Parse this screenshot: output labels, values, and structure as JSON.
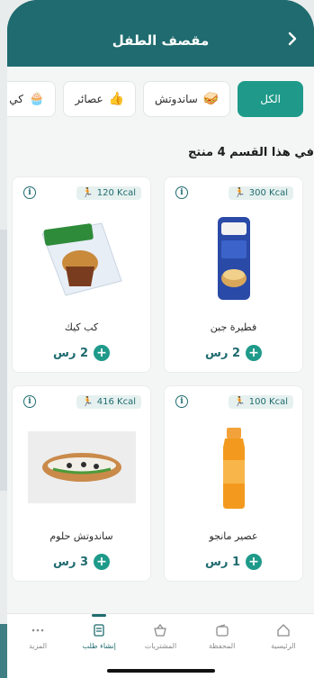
{
  "header": {
    "title": "مقصف الطفل"
  },
  "categories": [
    {
      "label": "الكل",
      "icon": "",
      "active": true
    },
    {
      "label": "ساندوتش",
      "icon": "🥪",
      "active": false
    },
    {
      "label": "عصائر",
      "icon": "👍",
      "active": false
    },
    {
      "label": "كي",
      "icon": "🧁",
      "active": false
    }
  ],
  "section": {
    "count_text": "في هذا القسم 4 منتج"
  },
  "products": [
    {
      "name": "فطيرة جبن",
      "kcal": "300 Kcal",
      "price": "2 رس"
    },
    {
      "name": "كب كيك",
      "kcal": "120 Kcal",
      "price": "2 رس"
    },
    {
      "name": "عصير مانجو",
      "kcal": "100 Kcal",
      "price": "1 رس"
    },
    {
      "name": "ساندوتش حلوم",
      "kcal": "416 Kcal",
      "price": "3 رس"
    }
  ],
  "tabbar": {
    "items": [
      {
        "label": "الرئيسية",
        "icon": "home-icon"
      },
      {
        "label": "المحفظة",
        "icon": "wallet-icon"
      },
      {
        "label": "المشتريات",
        "icon": "basket-icon"
      },
      {
        "label": "إنشاء طلب",
        "icon": "create-order-icon",
        "active": true
      },
      {
        "label": "المزيد",
        "icon": "more-icon"
      }
    ]
  },
  "colors": {
    "primary": "#1f6b6f",
    "accent": "#1f9a8a"
  }
}
